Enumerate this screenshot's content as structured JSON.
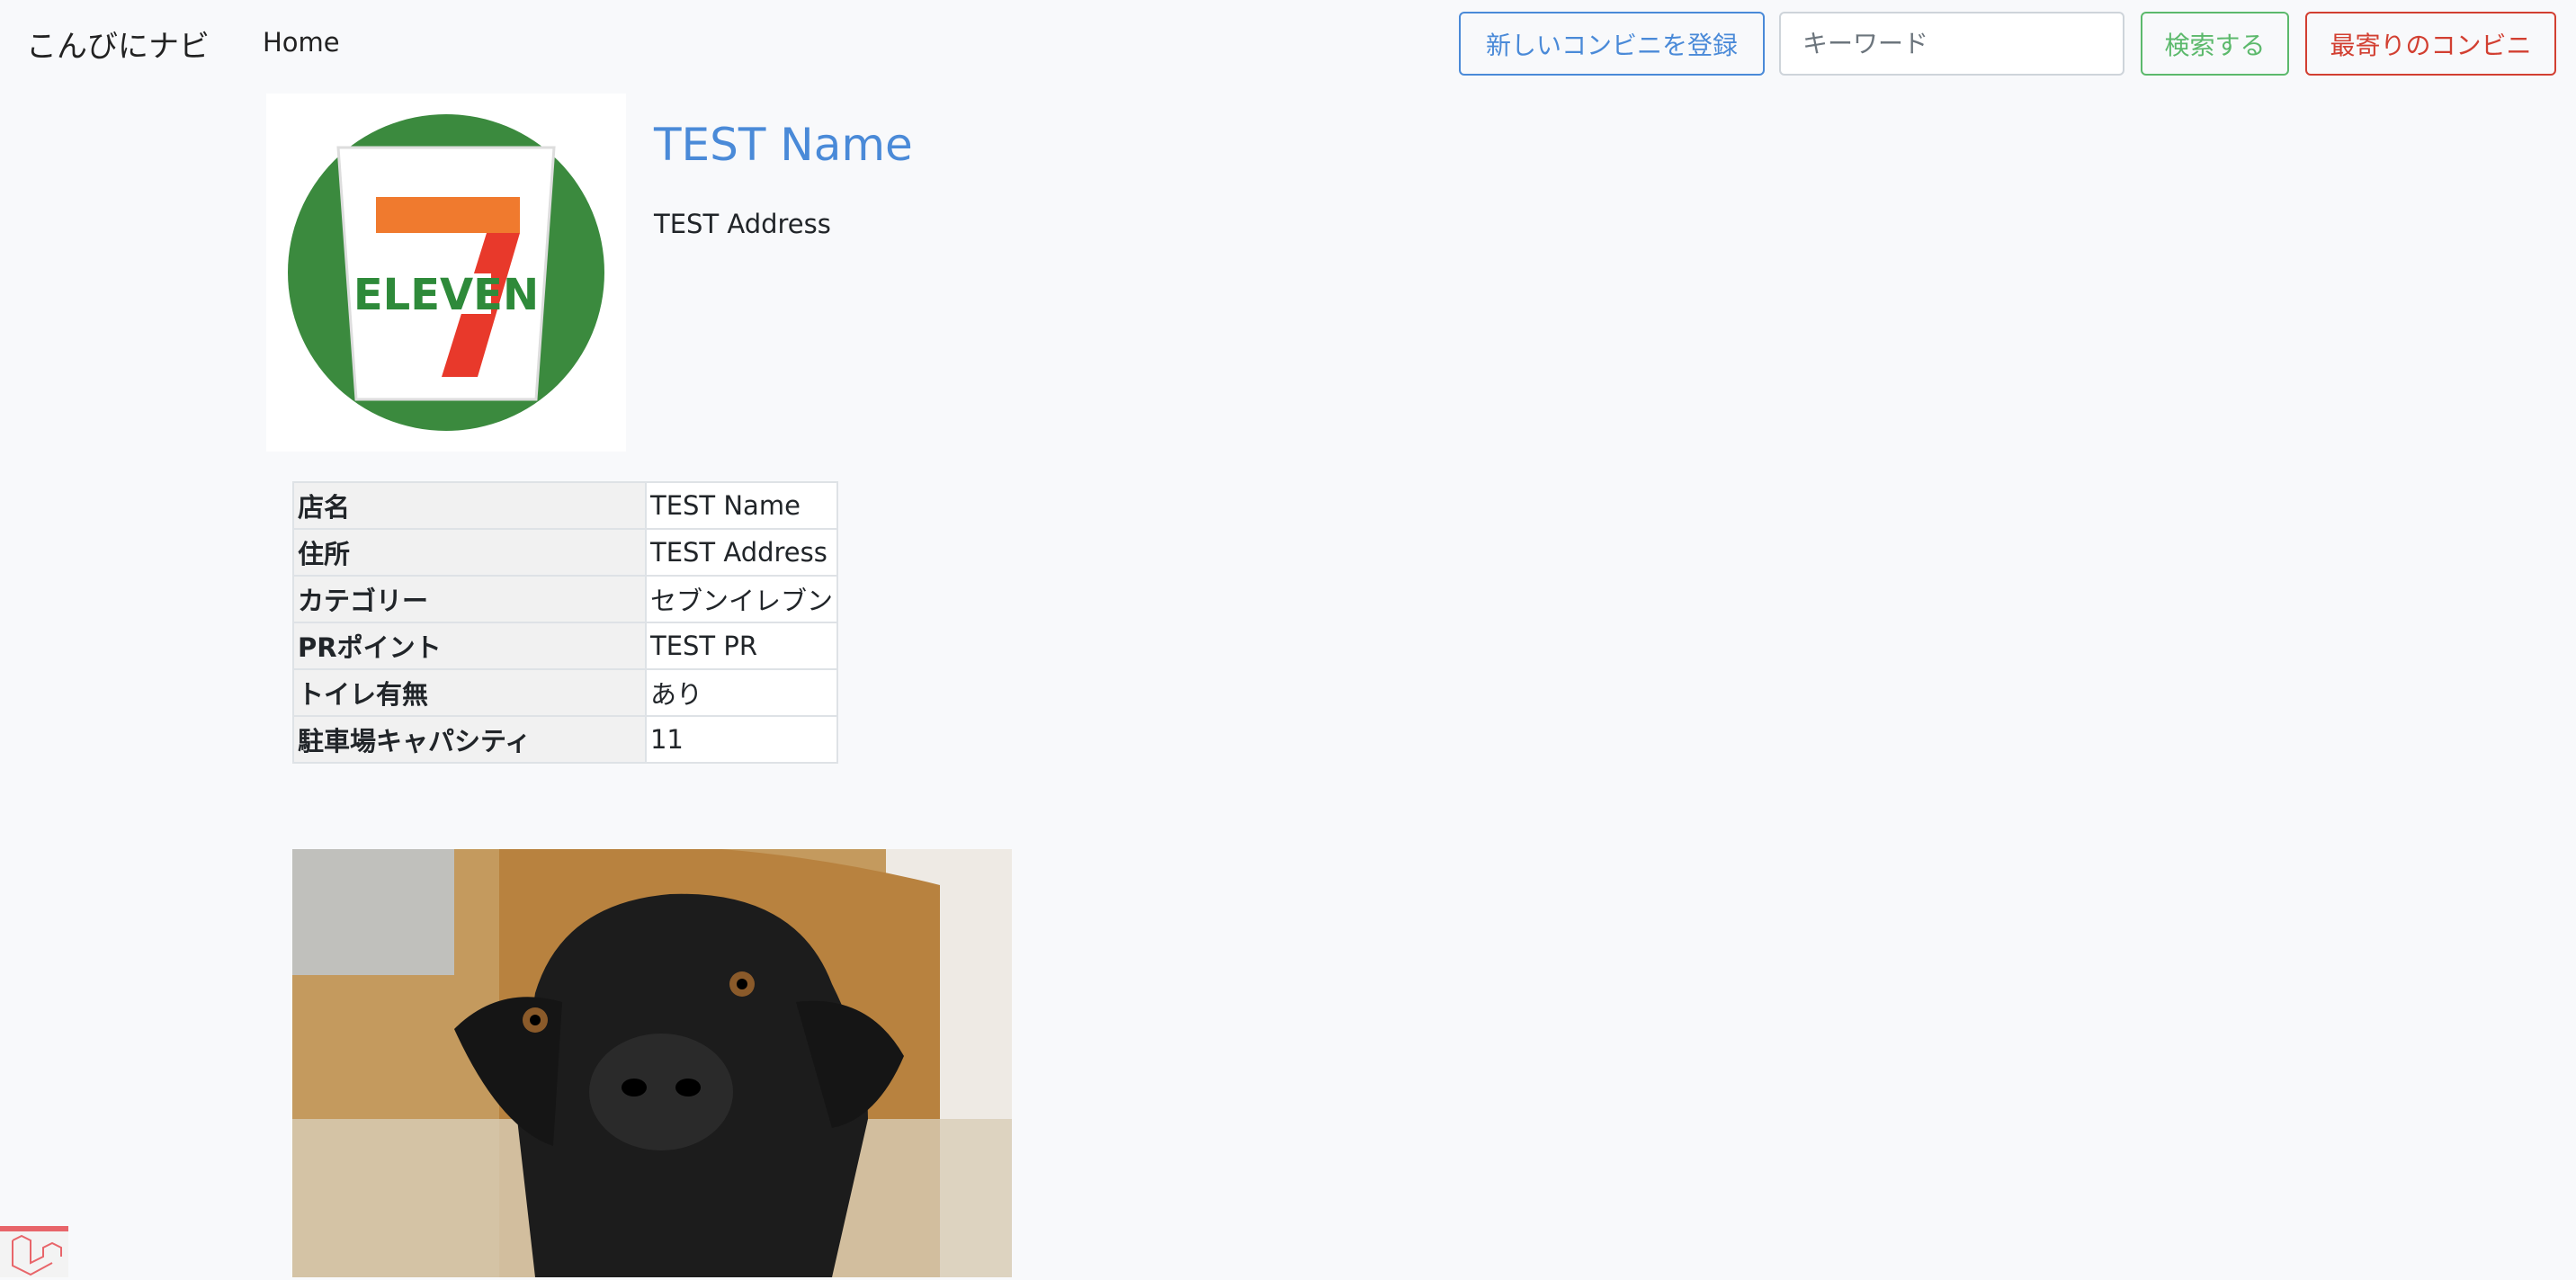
{
  "navbar": {
    "brand": "こんびにナビ",
    "home": "Home",
    "new_store_button": "新しいコンビニを登録",
    "keyword_placeholder": "キーワード",
    "search_button": "検索する",
    "nearest_button": "最寄りのコンビニ"
  },
  "store": {
    "name": "TEST Name",
    "address": "TEST Address",
    "logo_text": "ELEVEN"
  },
  "details": [
    {
      "label": "店名",
      "value": "TEST Name"
    },
    {
      "label": "住所",
      "value": "TEST Address"
    },
    {
      "label": "カテゴリー",
      "value": "セブンイレブン"
    },
    {
      "label": "PRポイント",
      "value": "TEST PR"
    },
    {
      "label": "トイレ有無",
      "value": "あり"
    },
    {
      "label": "駐車場キャパシティ",
      "value": "11"
    }
  ],
  "colors": {
    "primary": "#4a8ad8",
    "success": "#5cb96c",
    "danger": "#d23f31"
  }
}
